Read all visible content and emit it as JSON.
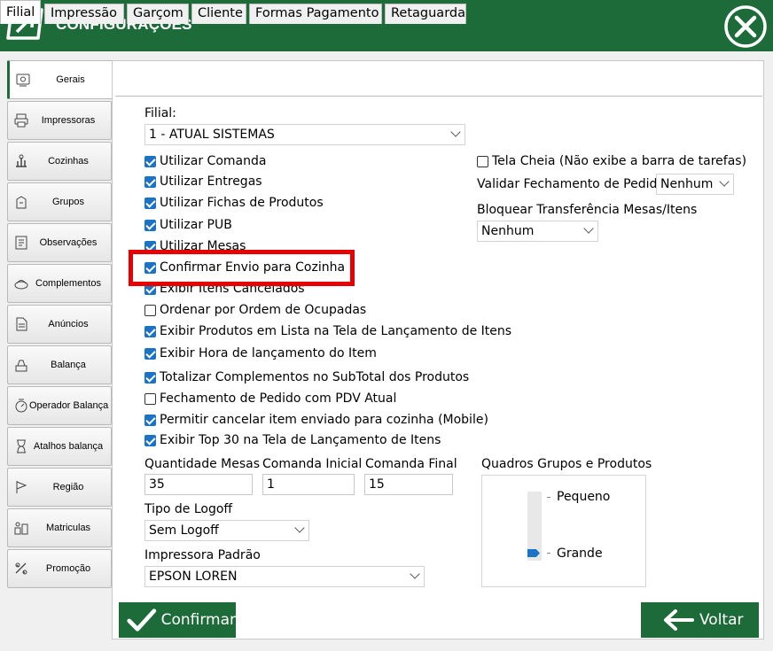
{
  "window": {
    "title": "CONFIGURAÇÕES"
  },
  "sidebar": {
    "items": [
      {
        "label": "Gerais",
        "icon": "settings-icon",
        "active": true
      },
      {
        "label": "Impressoras",
        "icon": "printer-icon"
      },
      {
        "label": "Cozinhas",
        "icon": "kitchen-icon"
      },
      {
        "label": "Grupos",
        "icon": "groups-icon"
      },
      {
        "label": "Observações",
        "icon": "notes-icon"
      },
      {
        "label": "Complementos",
        "icon": "complements-icon"
      },
      {
        "label": "Anúncios",
        "icon": "document-icon"
      },
      {
        "label": "Balança",
        "icon": "scale-icon"
      },
      {
        "label": "Operador Balança",
        "icon": "scale-operator-icon"
      },
      {
        "label": "Atalhos balança",
        "icon": "hourglass-icon"
      },
      {
        "label": "Região",
        "icon": "flag-icon"
      },
      {
        "label": "Matriculas",
        "icon": "registration-icon"
      },
      {
        "label": "Promoção",
        "icon": "promotion-icon"
      }
    ]
  },
  "tabs": [
    "Filial",
    "Impressão",
    "Garçom",
    "Cliente",
    "Formas Pagamento",
    "Retaguarda"
  ],
  "filial": {
    "label": "Filial:",
    "value": "1 - ATUAL SISTEMAS"
  },
  "checks": [
    {
      "label": "Utilizar Comanda",
      "checked": true
    },
    {
      "label": "Utilizar Entregas",
      "checked": true
    },
    {
      "label": "Utilizar Fichas de Produtos",
      "checked": true
    },
    {
      "label": "Utilizar PUB",
      "checked": true
    },
    {
      "label": "Utilizar Mesas",
      "checked": true
    },
    {
      "label": "Confirmar Envio para Cozinha",
      "checked": true
    },
    {
      "label": "Exibir Itens Cancelados",
      "checked": true
    },
    {
      "label": "Ordenar por Ordem de Ocupadas",
      "checked": false
    },
    {
      "label": "Exibir Produtos em Lista na Tela de Lançamento de Itens",
      "checked": true
    },
    {
      "label": "Exibir Hora de lançamento do Item",
      "checked": true
    },
    {
      "label": "Totalizar Complementos no SubTotal dos Produtos",
      "checked": true
    },
    {
      "label": "Fechamento de Pedido com PDV Atual",
      "checked": false
    },
    {
      "label": "Permitir cancelar item enviado para cozinha (Mobile)",
      "checked": true
    },
    {
      "label": "Exibir Top 30 na Tela de Lançamento de Itens",
      "checked": true
    }
  ],
  "right": {
    "tela_cheia": {
      "label": "Tela Cheia (Não exibe a barra de tarefas)",
      "checked": false
    },
    "validar": {
      "label": "Validar Fechamento de Pedido",
      "value": "Nenhum"
    },
    "bloquear": {
      "label": "Bloquear Transferência Mesas/Itens",
      "value": "Nenhum"
    }
  },
  "quantidades": {
    "mesas": {
      "label": "Quantidade Mesas",
      "value": "35"
    },
    "comanda_inicial": {
      "label": "Comanda Inicial",
      "value": "1"
    },
    "comanda_final": {
      "label": "Comanda Final",
      "value": "15"
    }
  },
  "logoff": {
    "label": "Tipo de Logoff",
    "value": "Sem Logoff"
  },
  "impressora": {
    "label": "Impressora Padrão",
    "value": "EPSON LOREN"
  },
  "quadros": {
    "label": "Quadros Grupos e Produtos",
    "top_label": "Pequeno",
    "bottom_label": "Grande",
    "level": 1.0
  },
  "buttons": {
    "confirm": "Confirmar",
    "back": "Voltar"
  },
  "colors": {
    "brand": "#1e6b3a",
    "accent": "#1a73c7",
    "highlight": "#e60000"
  }
}
